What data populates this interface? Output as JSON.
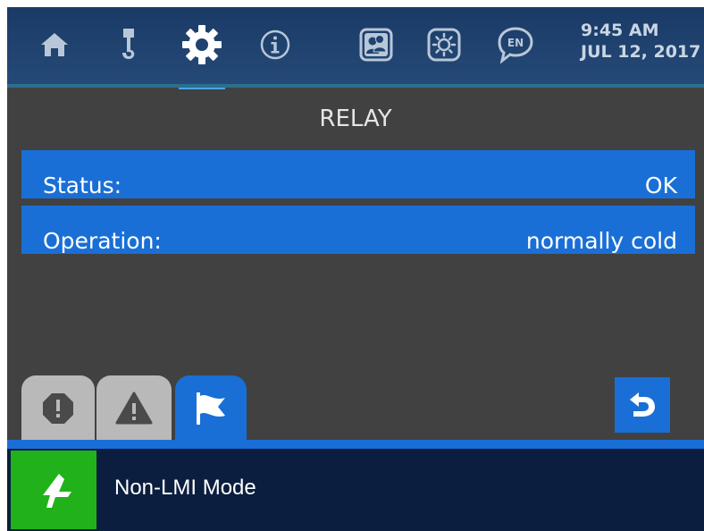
{
  "colors": {
    "accent_blue": "#1a6fd6",
    "topbar": "#1a3a66",
    "background": "#414141",
    "mode_green": "#21b21b",
    "bottombar": "#0b1e3f"
  },
  "nav": {
    "items": [
      {
        "icon": "home-icon"
      },
      {
        "icon": "crane-hook-icon"
      },
      {
        "icon": "gear-icon",
        "active": true
      },
      {
        "icon": "info-icon"
      },
      {
        "icon": "users-icon"
      },
      {
        "icon": "brightness-icon"
      },
      {
        "icon": "language-icon",
        "text": "EN"
      }
    ],
    "time": "9:45 AM",
    "date": "JUL 12, 2017"
  },
  "main": {
    "title": "RELAY",
    "rows": [
      {
        "label": "Status:",
        "value": "OK"
      },
      {
        "label": "Operation:",
        "value": "normally cold"
      }
    ]
  },
  "tabs": [
    {
      "icon": "octagon-exclamation-icon"
    },
    {
      "icon": "warning-triangle-icon"
    },
    {
      "icon": "flag-icon",
      "active": true
    }
  ],
  "back_button": {
    "icon": "back-arrow-icon"
  },
  "footer": {
    "mode_icon": "mode-arrow-icon",
    "mode_label": "Non-LMI Mode"
  }
}
